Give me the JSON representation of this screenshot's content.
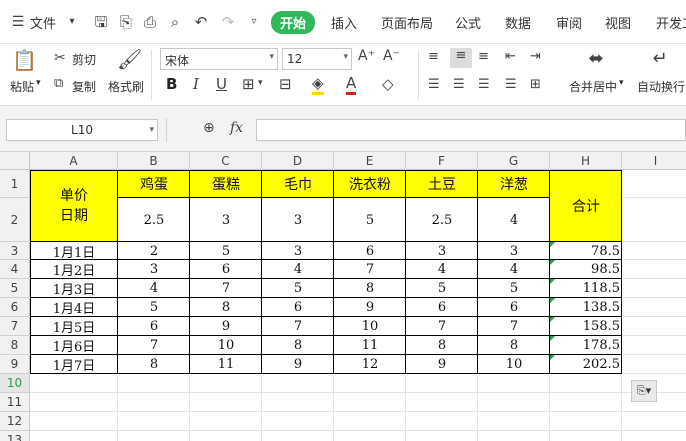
{
  "menu": {
    "file": "文件",
    "tabs": [
      "开始",
      "插入",
      "页面布局",
      "公式",
      "数据",
      "审阅",
      "视图",
      "开发工"
    ]
  },
  "ribbon": {
    "paste": "粘贴",
    "cut": "剪切",
    "copy": "复制",
    "format_painter": "格式刷",
    "font_name": "宋体",
    "font_size": "12",
    "bold": "B",
    "italic": "I",
    "underline": "U",
    "merge_center": "合并居中",
    "auto_wrap": "自动换行"
  },
  "formula_bar": {
    "name_box": "L10",
    "fx": "fx",
    "formula": ""
  },
  "columns": [
    "A",
    "B",
    "C",
    "D",
    "E",
    "F",
    "G",
    "H",
    "I"
  ],
  "rows": [
    "1",
    "2",
    "3",
    "4",
    "5",
    "6",
    "7",
    "8",
    "9",
    "10",
    "11",
    "12",
    "13"
  ],
  "table": {
    "header_label_top": "单价",
    "header_label_bottom": "日期",
    "products": [
      "鸡蛋",
      "蛋糕",
      "毛巾",
      "洗衣粉",
      "土豆",
      "洋葱"
    ],
    "prices": [
      "2.5",
      "3",
      "3",
      "5",
      "2.5",
      "4"
    ],
    "total_header": "合计",
    "data_rows": [
      {
        "date": "1月1日",
        "values": [
          "2",
          "5",
          "3",
          "6",
          "3",
          "3"
        ],
        "total": "78.5"
      },
      {
        "date": "1月2日",
        "values": [
          "3",
          "6",
          "4",
          "7",
          "4",
          "4"
        ],
        "total": "98.5"
      },
      {
        "date": "1月3日",
        "values": [
          "4",
          "7",
          "5",
          "8",
          "5",
          "5"
        ],
        "total": "118.5"
      },
      {
        "date": "1月4日",
        "values": [
          "5",
          "8",
          "6",
          "9",
          "6",
          "6"
        ],
        "total": "138.5"
      },
      {
        "date": "1月5日",
        "values": [
          "6",
          "9",
          "7",
          "10",
          "7",
          "7"
        ],
        "total": "158.5"
      },
      {
        "date": "1月6日",
        "values": [
          "7",
          "10",
          "8",
          "11",
          "8",
          "8"
        ],
        "total": "178.5"
      },
      {
        "date": "1月7日",
        "values": [
          "8",
          "11",
          "9",
          "12",
          "9",
          "10"
        ],
        "total": "202.5"
      }
    ]
  },
  "colors": {
    "accent": "#2fb85a",
    "highlight": "#ffff00",
    "error_marker": "#2a9d4a"
  }
}
